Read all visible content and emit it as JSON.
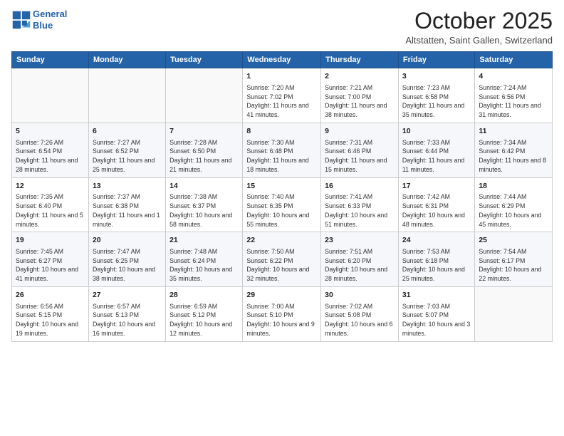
{
  "header": {
    "logo_line1": "General",
    "logo_line2": "Blue",
    "month": "October 2025",
    "location": "Altstatten, Saint Gallen, Switzerland"
  },
  "weekdays": [
    "Sunday",
    "Monday",
    "Tuesday",
    "Wednesday",
    "Thursday",
    "Friday",
    "Saturday"
  ],
  "weeks": [
    [
      {
        "day": "",
        "info": ""
      },
      {
        "day": "",
        "info": ""
      },
      {
        "day": "",
        "info": ""
      },
      {
        "day": "1",
        "info": "Sunrise: 7:20 AM\nSunset: 7:02 PM\nDaylight: 11 hours and 41 minutes."
      },
      {
        "day": "2",
        "info": "Sunrise: 7:21 AM\nSunset: 7:00 PM\nDaylight: 11 hours and 38 minutes."
      },
      {
        "day": "3",
        "info": "Sunrise: 7:23 AM\nSunset: 6:58 PM\nDaylight: 11 hours and 35 minutes."
      },
      {
        "day": "4",
        "info": "Sunrise: 7:24 AM\nSunset: 6:56 PM\nDaylight: 11 hours and 31 minutes."
      }
    ],
    [
      {
        "day": "5",
        "info": "Sunrise: 7:26 AM\nSunset: 6:54 PM\nDaylight: 11 hours and 28 minutes."
      },
      {
        "day": "6",
        "info": "Sunrise: 7:27 AM\nSunset: 6:52 PM\nDaylight: 11 hours and 25 minutes."
      },
      {
        "day": "7",
        "info": "Sunrise: 7:28 AM\nSunset: 6:50 PM\nDaylight: 11 hours and 21 minutes."
      },
      {
        "day": "8",
        "info": "Sunrise: 7:30 AM\nSunset: 6:48 PM\nDaylight: 11 hours and 18 minutes."
      },
      {
        "day": "9",
        "info": "Sunrise: 7:31 AM\nSunset: 6:46 PM\nDaylight: 11 hours and 15 minutes."
      },
      {
        "day": "10",
        "info": "Sunrise: 7:33 AM\nSunset: 6:44 PM\nDaylight: 11 hours and 11 minutes."
      },
      {
        "day": "11",
        "info": "Sunrise: 7:34 AM\nSunset: 6:42 PM\nDaylight: 11 hours and 8 minutes."
      }
    ],
    [
      {
        "day": "12",
        "info": "Sunrise: 7:35 AM\nSunset: 6:40 PM\nDaylight: 11 hours and 5 minutes."
      },
      {
        "day": "13",
        "info": "Sunrise: 7:37 AM\nSunset: 6:38 PM\nDaylight: 11 hours and 1 minute."
      },
      {
        "day": "14",
        "info": "Sunrise: 7:38 AM\nSunset: 6:37 PM\nDaylight: 10 hours and 58 minutes."
      },
      {
        "day": "15",
        "info": "Sunrise: 7:40 AM\nSunset: 6:35 PM\nDaylight: 10 hours and 55 minutes."
      },
      {
        "day": "16",
        "info": "Sunrise: 7:41 AM\nSunset: 6:33 PM\nDaylight: 10 hours and 51 minutes."
      },
      {
        "day": "17",
        "info": "Sunrise: 7:42 AM\nSunset: 6:31 PM\nDaylight: 10 hours and 48 minutes."
      },
      {
        "day": "18",
        "info": "Sunrise: 7:44 AM\nSunset: 6:29 PM\nDaylight: 10 hours and 45 minutes."
      }
    ],
    [
      {
        "day": "19",
        "info": "Sunrise: 7:45 AM\nSunset: 6:27 PM\nDaylight: 10 hours and 41 minutes."
      },
      {
        "day": "20",
        "info": "Sunrise: 7:47 AM\nSunset: 6:25 PM\nDaylight: 10 hours and 38 minutes."
      },
      {
        "day": "21",
        "info": "Sunrise: 7:48 AM\nSunset: 6:24 PM\nDaylight: 10 hours and 35 minutes."
      },
      {
        "day": "22",
        "info": "Sunrise: 7:50 AM\nSunset: 6:22 PM\nDaylight: 10 hours and 32 minutes."
      },
      {
        "day": "23",
        "info": "Sunrise: 7:51 AM\nSunset: 6:20 PM\nDaylight: 10 hours and 28 minutes."
      },
      {
        "day": "24",
        "info": "Sunrise: 7:53 AM\nSunset: 6:18 PM\nDaylight: 10 hours and 25 minutes."
      },
      {
        "day": "25",
        "info": "Sunrise: 7:54 AM\nSunset: 6:17 PM\nDaylight: 10 hours and 22 minutes."
      }
    ],
    [
      {
        "day": "26",
        "info": "Sunrise: 6:56 AM\nSunset: 5:15 PM\nDaylight: 10 hours and 19 minutes."
      },
      {
        "day": "27",
        "info": "Sunrise: 6:57 AM\nSunset: 5:13 PM\nDaylight: 10 hours and 16 minutes."
      },
      {
        "day": "28",
        "info": "Sunrise: 6:59 AM\nSunset: 5:12 PM\nDaylight: 10 hours and 12 minutes."
      },
      {
        "day": "29",
        "info": "Sunrise: 7:00 AM\nSunset: 5:10 PM\nDaylight: 10 hours and 9 minutes."
      },
      {
        "day": "30",
        "info": "Sunrise: 7:02 AM\nSunset: 5:08 PM\nDaylight: 10 hours and 6 minutes."
      },
      {
        "day": "31",
        "info": "Sunrise: 7:03 AM\nSunset: 5:07 PM\nDaylight: 10 hours and 3 minutes."
      },
      {
        "day": "",
        "info": ""
      }
    ]
  ]
}
